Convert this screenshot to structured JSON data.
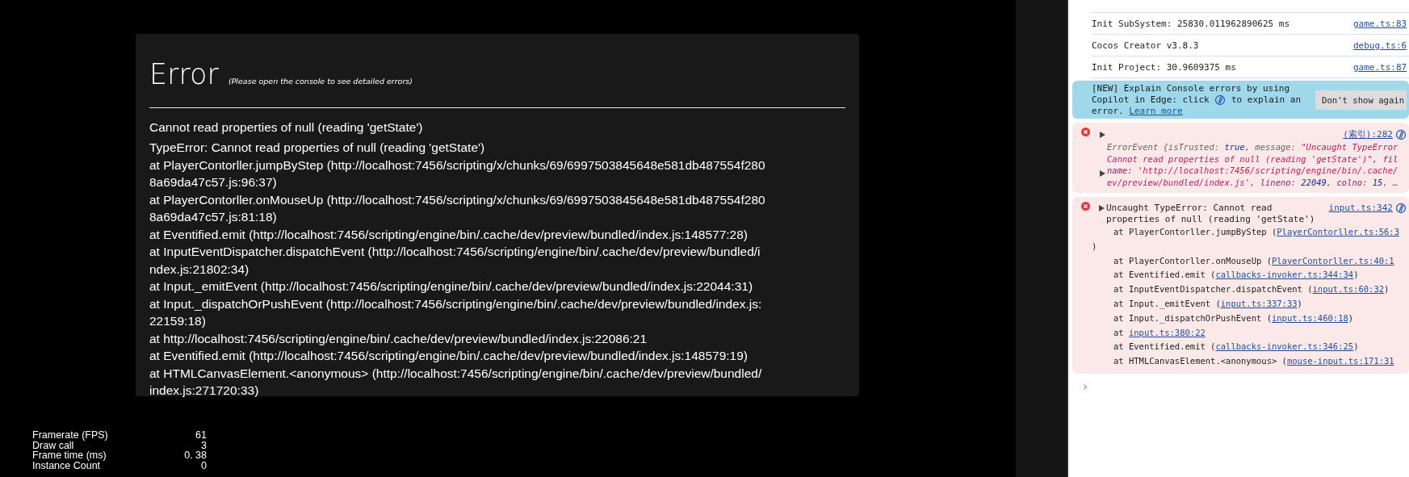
{
  "error_overlay": {
    "title": "Error",
    "hint": "(Please open the console to see detailed errors)",
    "message": "Cannot read properties of null (reading 'getState')",
    "stack_lines": [
      "TypeError: Cannot read properties of null (reading 'getState')",
      "at PlayerContorller.jumpByStep (http://localhost:7456/scripting/x/chunks/69/6997503845648e581db487554f280",
      "8a69da47c57.js:96:37)",
      "at PlayerContorller.onMouseUp (http://localhost:7456/scripting/x/chunks/69/6997503845648e581db487554f280",
      "8a69da47c57.js:81:18)",
      "at Eventified.emit (http://localhost:7456/scripting/engine/bin/.cache/dev/preview/bundled/index.js:148577:28)",
      "at InputEventDispatcher.dispatchEvent (http://localhost:7456/scripting/engine/bin/.cache/dev/preview/bundled/i",
      "ndex.js:21802:34)",
      "at Input._emitEvent (http://localhost:7456/scripting/engine/bin/.cache/dev/preview/bundled/index.js:22044:31)",
      "at Input._dispatchOrPushEvent (http://localhost:7456/scripting/engine/bin/.cache/dev/preview/bundled/index.js:",
      "22159:18)",
      "at http://localhost:7456/scripting/engine/bin/.cache/dev/preview/bundled/index.js:22086:21",
      "at Eventified.emit (http://localhost:7456/scripting/engine/bin/.cache/dev/preview/bundled/index.js:148579:19)",
      "at HTMLCanvasElement.<anonymous> (http://localhost:7456/scripting/engine/bin/.cache/dev/preview/bundled/",
      "index.js:271720:33)"
    ]
  },
  "stats": [
    {
      "label": "Framerate (FPS)",
      "value": "61"
    },
    {
      "label": "Draw call",
      "value": "3"
    },
    {
      "label": "Frame time (ms)",
      "value": "0. 38"
    },
    {
      "label": "Instance Count",
      "value": "0"
    }
  ],
  "console": {
    "logs": [
      {
        "text": "Init SubSystem: 25830.011962890625 ms",
        "source": "game.ts:83"
      },
      {
        "text": "Cocos Creator v3.8.3",
        "source": "debug.ts:6"
      },
      {
        "text": "Init Project: 30.9609375 ms",
        "source": "game.ts:87"
      }
    ],
    "banner": {
      "text_before": "[NEW] Explain Console errors by using Copilot in Edge: click",
      "text_after": "to explain an error.",
      "link": "Learn more",
      "button": "Don't show again"
    },
    "errors": [
      {
        "kind": "event",
        "source": "(索引):282",
        "lines": [
          [
            {
              "text": "ErrorEvent {isTrusted: ",
              "kind": "plain"
            },
            {
              "text": "true",
              "kind": "keyword"
            },
            {
              "text": ", message: ",
              "kind": "plain"
            },
            {
              "text": "\"Uncaught TypeError",
              "kind": "string"
            }
          ],
          [
            {
              "text": "Cannot read properties of null (reading 'getState')\"",
              "kind": "string"
            },
            {
              "text": ", fil",
              "kind": "key"
            }
          ],
          [
            {
              "text": "name: ",
              "kind": "key"
            },
            {
              "text": "'http://localhost:7456/scripting/engine/bin/.cache/",
              "kind": "string"
            }
          ],
          [
            {
              "text": "ev/preview/bundled/index.js'",
              "kind": "string"
            },
            {
              "text": ", ",
              "kind": "plain"
            },
            {
              "text": "lineno: ",
              "kind": "key"
            },
            {
              "text": "22049",
              "kind": "number"
            },
            {
              "text": ", ",
              "kind": "plain"
            },
            {
              "text": "colno: ",
              "kind": "key"
            },
            {
              "text": "15",
              "kind": "number"
            },
            {
              "text": ", …",
              "kind": "plain"
            }
          ]
        ]
      },
      {
        "kind": "exception",
        "header": "Uncaught TypeError: Cannot read properties of null (reading 'getState')",
        "source": "input.ts:342",
        "frames": [
          {
            "text": "at PlayerContorller.jumpByStep (",
            "link": "PlayerContorller.ts:56:3",
            "tail": ")"
          },
          {
            "text": "at PlayerContorller.onMouseUp (",
            "link": "PlayerContorller.ts:40:1"
          },
          {
            "text": "at Eventified.emit (",
            "link": "callbacks-invoker.ts:344:34",
            "close": ")"
          },
          {
            "text": "at InputEventDispatcher.dispatchEvent (",
            "link": "input.ts:60:32",
            "close": ")"
          },
          {
            "text": "at Input._emitEvent (",
            "link": "input.ts:337:33",
            "close": ")"
          },
          {
            "text": "at Input._dispatchOrPushEvent (",
            "link": "input.ts:460:18",
            "close": ")"
          },
          {
            "text": "at ",
            "link": "input.ts:380:22"
          },
          {
            "text": "at Eventified.emit (",
            "link": "callbacks-invoker.ts:346:25",
            "close": ")"
          },
          {
            "text": "at HTMLCanvasElement.<anonymous> (",
            "link": "mouse-input.ts:171:31"
          }
        ]
      }
    ],
    "prompt": "›"
  }
}
